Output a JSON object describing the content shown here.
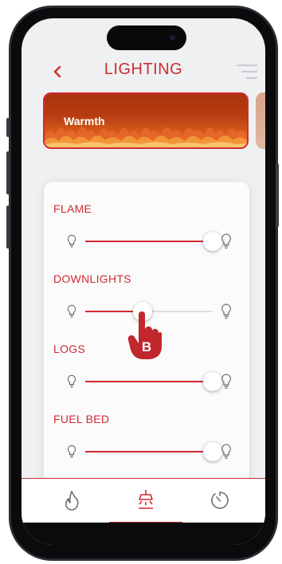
{
  "header": {
    "title": "LIGHTING",
    "back_icon": "chevron-left-icon",
    "menu_icon": "menu-icon"
  },
  "scenes": [
    {
      "label": "Warmth",
      "selected": true
    }
  ],
  "controls": [
    {
      "label": "FLAME",
      "level": 1.0
    },
    {
      "label": "DOWNLIGHTS",
      "level": 0.45
    },
    {
      "label": "LOGS",
      "level": 1.0
    },
    {
      "label": "FUEL BED",
      "level": 1.0
    }
  ],
  "annotation": {
    "marker": "B"
  },
  "tabs": [
    {
      "icon": "flame-icon",
      "active": false
    },
    {
      "icon": "ceiling-light-icon",
      "active": true
    },
    {
      "icon": "timer-icon",
      "active": false
    }
  ],
  "colors": {
    "accent": "#d02b32",
    "background": "#eef0f2",
    "scene_fill": "#b73c10"
  }
}
